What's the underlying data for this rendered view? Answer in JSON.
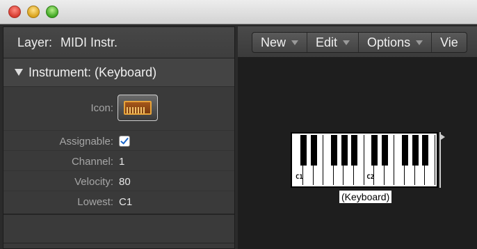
{
  "window": {
    "controls": [
      "close",
      "minimize",
      "zoom"
    ]
  },
  "inspector": {
    "layer_label": "Layer:",
    "layer_value": "MIDI Instr.",
    "section_title": "Instrument: (Keyboard)",
    "params": {
      "icon_label": "Icon:",
      "assignable_label": "Assignable:",
      "assignable_checked": true,
      "channel_label": "Channel:",
      "channel_value": "1",
      "velocity_label": "Velocity:",
      "velocity_value": "80",
      "lowest_label": "Lowest:",
      "lowest_value": "C1"
    }
  },
  "toolbar": {
    "menus": [
      {
        "label": "New"
      },
      {
        "label": "Edit"
      },
      {
        "label": "Options"
      },
      {
        "label": "Vie"
      }
    ]
  },
  "canvas": {
    "object": {
      "name": "(Keyboard)",
      "octave_labels": [
        "C1",
        "C2"
      ]
    }
  },
  "colors": {
    "accent_icon": "#e7a43b",
    "check": "#1a66c9"
  }
}
